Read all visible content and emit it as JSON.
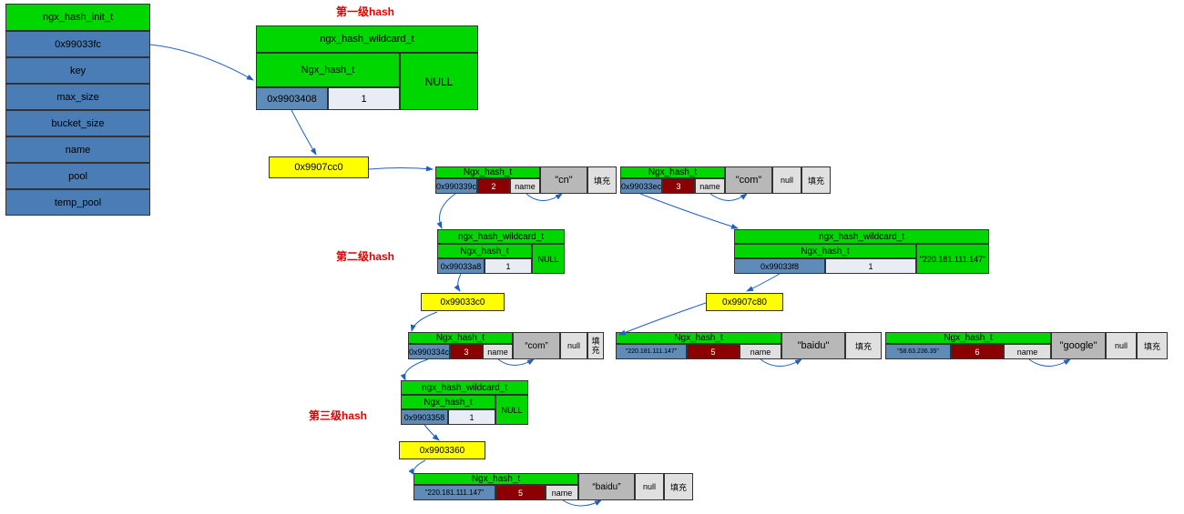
{
  "labels": {
    "level1": "第一级hash",
    "level2": "第二级hash",
    "level3": "第三级hash"
  },
  "initTable": {
    "header": "ngx_hash_init_t",
    "rows": [
      "0x99033fc",
      "key",
      "max_size",
      "bucket_size",
      "name",
      "pool",
      "temp_pool"
    ]
  },
  "wc1": {
    "title": "ngx_hash_wildcard_t",
    "hashLabel": "Ngx_hash_t",
    "addr": "0x9903408",
    "size": "1",
    "null": "NULL"
  },
  "bucket1": "0x9907cc0",
  "entry_cn": {
    "hashLabel": "Ngx_hash_t",
    "addr": "0x990339c",
    "len": "2",
    "nameKey": "name",
    "name": "\"cn\"",
    "fill": "填充"
  },
  "entry_com": {
    "hashLabel": "Ngx_hash_t",
    "addr": "0x99033ec",
    "len": "3",
    "nameKey": "name",
    "name": "\"com\"",
    "null": "null",
    "fill": "填充"
  },
  "wc2a": {
    "title": "ngx_hash_wildcard_t",
    "hashLabel": "Ngx_hash_t",
    "addr": "0x99033a8",
    "size": "1",
    "null": "NULL"
  },
  "wc2b": {
    "title": "ngx_hash_wildcard_t",
    "hashLabel": "Ngx_hash_t",
    "addr": "0x99033f8",
    "size": "1",
    "ip": "\"220.181.111.147\""
  },
  "bucket2a": "0x99033c0",
  "bucket2b": "0x9907c80",
  "entry_com2": {
    "hashLabel": "Ngx_hash_t",
    "addr": "0x990334c",
    "len": "3",
    "nameKey": "name",
    "name": "“com”",
    "null": "null",
    "fill": "填充"
  },
  "entry_baidu": {
    "hashLabel": "Ngx_hash_t",
    "ip": "\"220.181.111.147\"",
    "len": "5",
    "nameKey": "name",
    "name": "\"baidu\"",
    "fill": "填充"
  },
  "entry_google": {
    "hashLabel": "Ngx_hash_t",
    "ip": "\"58.63.236.35\"",
    "len": "6",
    "nameKey": "name",
    "name": "\"google\"",
    "null": "null",
    "fill": "填充"
  },
  "wc3": {
    "title": "ngx_hash_wildcard_t",
    "hashLabel": "Ngx_hash_t",
    "addr": "0x9903358",
    "size": "1",
    "null": "NULL"
  },
  "bucket3": "0x9903360",
  "entry_baidu3": {
    "hashLabel": "Ngx_hash_t",
    "ip": "\"220.181.111.147\"",
    "len": "5",
    "nameKey": "name",
    "name": "“baidu”",
    "null": "null",
    "fill": "填充"
  }
}
